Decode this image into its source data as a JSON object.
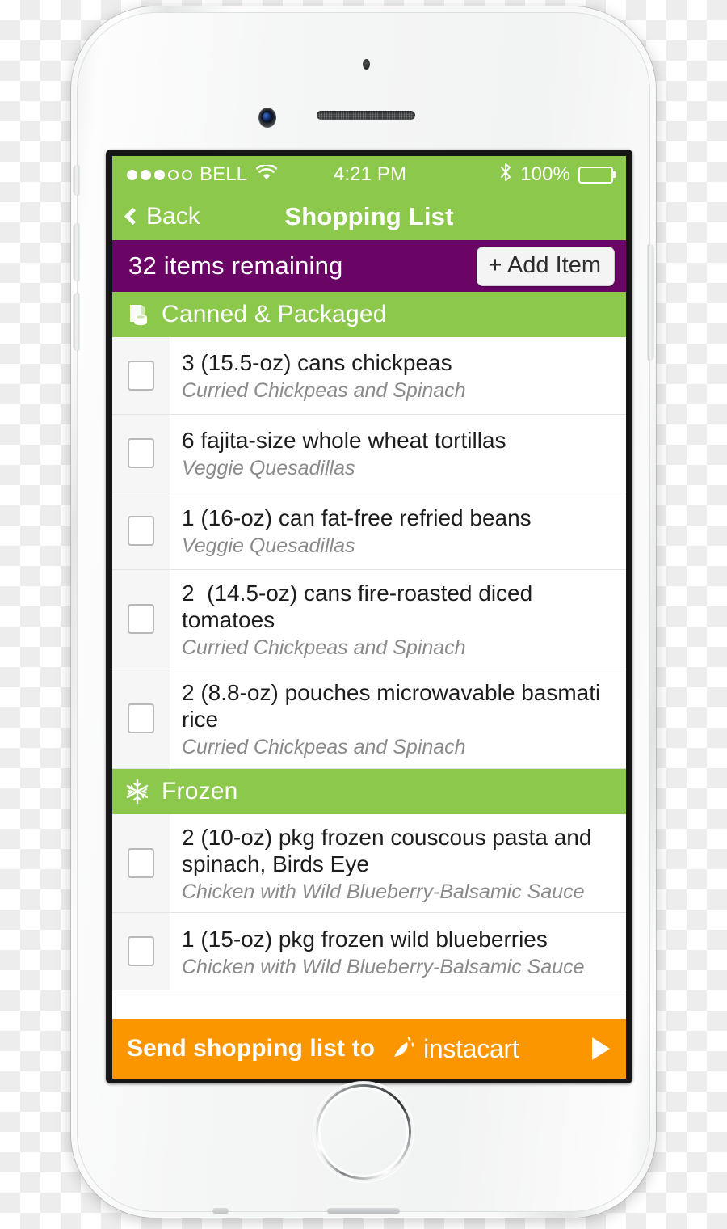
{
  "colors": {
    "green": "#8CC84B",
    "purple": "#6A0566",
    "orange": "#FB9500",
    "checkbox_border": "#b8b8b8",
    "subtitle_gray": "#8a8a8a"
  },
  "status_bar": {
    "signal_dots_filled": 3,
    "signal_dots_total": 5,
    "carrier": "BELL",
    "wifi_icon": "wifi-icon",
    "time": "4:21 PM",
    "bluetooth_icon": "bluetooth-icon",
    "battery_percent": "100%",
    "battery_level": 100
  },
  "nav_bar": {
    "back_label": "Back",
    "back_icon": "chevron-left-icon",
    "title": "Shopping List"
  },
  "summary_bar": {
    "remaining_text": "32 items remaining",
    "add_item_label": "+ Add Item"
  },
  "sections": [
    {
      "id": "canned-packaged",
      "label": "Canned & Packaged",
      "icon": "canned-packaged-icon",
      "items": [
        {
          "title": "3 (15.5-oz) cans chickpeas",
          "recipe": "Curried Chickpeas and Spinach",
          "checked": false
        },
        {
          "title": "6 fajita-size whole wheat tortillas",
          "recipe": "Veggie Quesadillas",
          "checked": false
        },
        {
          "title": "1 (16-oz) can fat-free refried beans",
          "recipe": "Veggie Quesadillas",
          "checked": false
        },
        {
          "title": "2  (14.5-oz) cans fire-roasted diced tomatoes",
          "recipe": "Curried Chickpeas and Spinach",
          "checked": false
        },
        {
          "title": "2 (8.8-oz) pouches microwavable basmati rice",
          "recipe": "Curried Chickpeas and Spinach",
          "checked": false
        }
      ]
    },
    {
      "id": "frozen",
      "label": "Frozen",
      "icon": "snowflake-icon",
      "items": [
        {
          "title": "2 (10-oz) pkg frozen couscous pasta and spinach, Birds Eye",
          "recipe": "Chicken with Wild Blueberry-Balsamic Sauce",
          "checked": false
        },
        {
          "title": "1 (15-oz) pkg frozen wild blueberries",
          "recipe": "Chicken with Wild Blueberry-Balsamic Sauce",
          "checked": false
        }
      ]
    }
  ],
  "footer": {
    "send_label": "Send shopping list to",
    "brand": "instacart",
    "brand_icon": "carrot-icon",
    "arrow_icon": "play-arrow-icon"
  }
}
